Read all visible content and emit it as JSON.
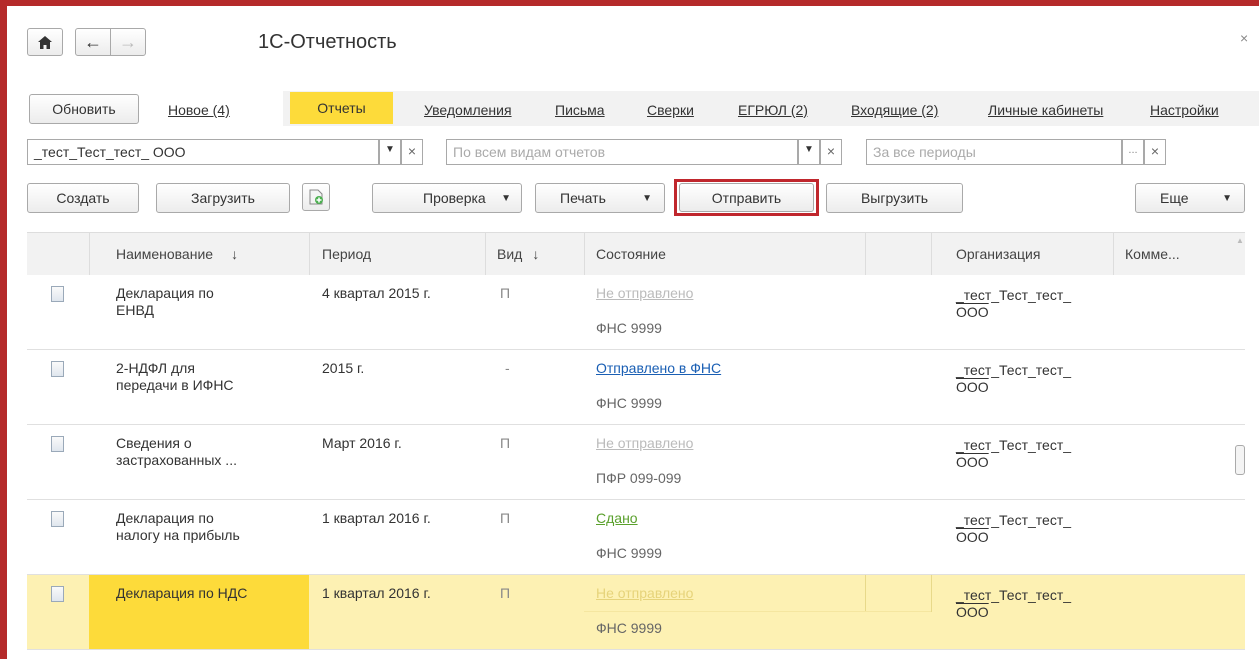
{
  "window": {
    "title": "1С-Отчетность"
  },
  "icons": {
    "home": "home-icon",
    "back": "arrow-left-icon",
    "forward": "arrow-right-icon",
    "close": "close-icon"
  },
  "nav": {
    "refresh": "Обновить",
    "new": "Новое (4)",
    "tabs": [
      "Отчеты",
      "Уведомления",
      "Письма",
      "Сверки",
      "ЕГРЮЛ (2)",
      "Входящие (2)",
      "Личные кабинеты",
      "Настройки"
    ]
  },
  "filters": {
    "org": "_тест_Тест_тест_ ООО",
    "kind_placeholder": "По всем видам отчетов",
    "period_placeholder": "За все периоды",
    "dots": "..."
  },
  "toolbar": {
    "create": "Создать",
    "load": "Загрузить",
    "check": "Проверка",
    "print": "Печать",
    "send": "Отправить",
    "export": "Выгрузить",
    "more": "Еще"
  },
  "table": {
    "headers": {
      "name": "Наименование",
      "period": "Период",
      "kind": "Вид",
      "state": "Состояние",
      "org": "Организация",
      "comment": "Комме..."
    },
    "sort_arrow": "↓",
    "rows": [
      {
        "name1": "Декларация по",
        "name2": "ЕНВД",
        "period": "4 квартал 2015 г.",
        "kind": "П",
        "status": "Не отправлено",
        "agency": "ФНС 9999",
        "org1": "_тест_Тест_тест_",
        "org2": "ООО"
      },
      {
        "name1": "2-НДФЛ для",
        "name2": "передачи в ИФНС",
        "period": "2015 г.",
        "kind": "-",
        "status": "Отправлено в ФНС",
        "agency": "ФНС 9999",
        "org1": "_тест_Тест_тест_",
        "org2": "ООО"
      },
      {
        "name1": "Сведения о",
        "name2": "застрахованных ...",
        "period": "Март 2016 г.",
        "kind": "П",
        "status": "Не отправлено",
        "agency": "ПФР 099-099",
        "org1": "_тест_Тест_тест_",
        "org2": "ООО"
      },
      {
        "name1": "Декларация по",
        "name2": "налогу на прибыль",
        "period": "1 квартал 2016 г.",
        "kind": "П",
        "status": "Сдано",
        "agency": "ФНС 9999",
        "org1": "_тест_Тест_тест_",
        "org2": "ООО"
      },
      {
        "name1": "Декларация по НДС",
        "name2": "",
        "period": "1 квартал 2016 г.",
        "kind": "П",
        "status": "Не отправлено",
        "agency": "ФНС 9999",
        "org1": "_тест_Тест_тест_",
        "org2": "ООО"
      }
    ]
  },
  "colors": {
    "frame": "#b52a2a",
    "active_tab": "#fddb3a",
    "selected_row": "#fdf1b3",
    "send_highlight": "#c0272d",
    "link_blue": "#1a5fb4",
    "status_green": "#5aa02c"
  }
}
